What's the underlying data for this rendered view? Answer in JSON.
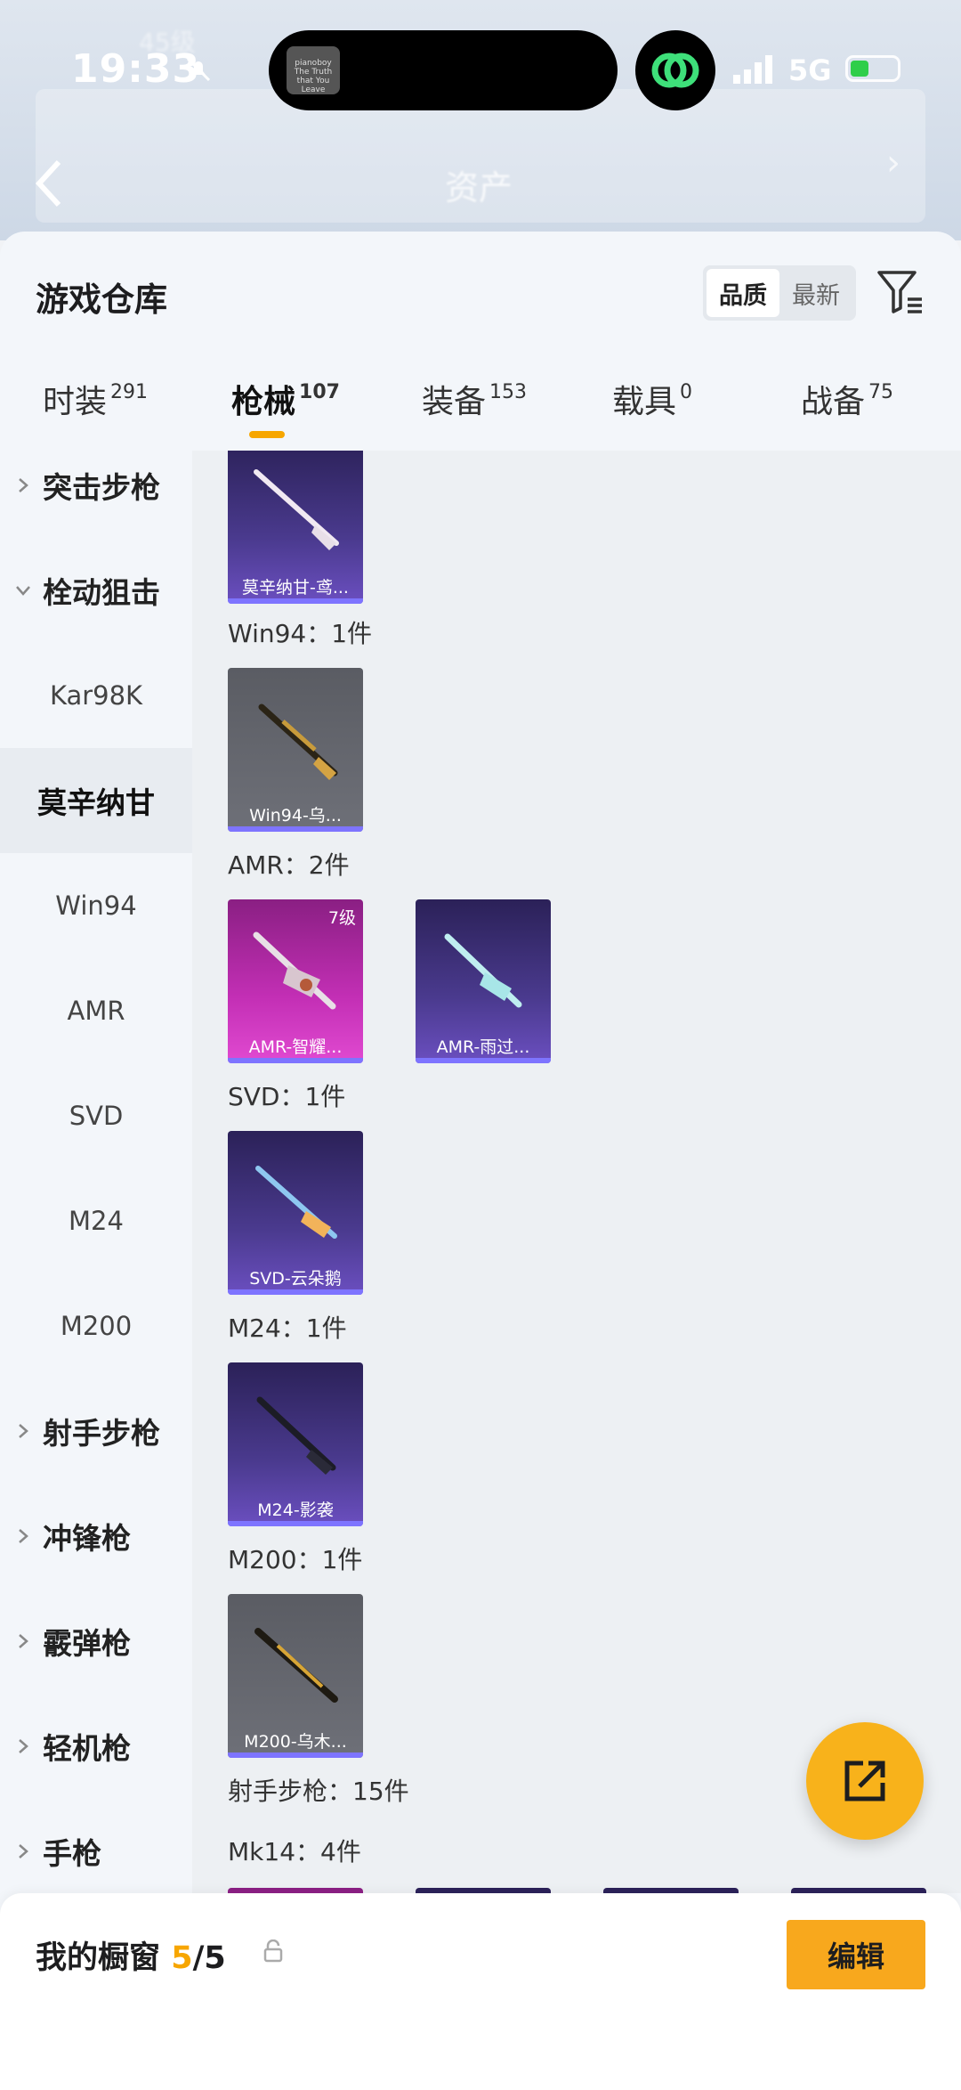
{
  "status_bar": {
    "time": "19:33",
    "network": "5G",
    "island_thumb_text": "pianoboy The Truth that You Leave"
  },
  "header": {
    "background_ghost_level": "45级",
    "assets_title": "资产"
  },
  "sheet": {
    "title": "游戏仓库",
    "sort": {
      "options": [
        "品质",
        "最新"
      ],
      "active": "品质"
    }
  },
  "tabs": [
    {
      "label": "时装",
      "count": "291",
      "active": false
    },
    {
      "label": "枪械",
      "count": "107",
      "active": true
    },
    {
      "label": "装备",
      "count": "153",
      "active": false
    },
    {
      "label": "载具",
      "count": "0",
      "active": false
    },
    {
      "label": "战备",
      "count": "75",
      "active": false
    }
  ],
  "subnav": [
    {
      "label": "突击步枪",
      "type": "group",
      "expanded": false
    },
    {
      "label": "栓动狙击",
      "type": "group",
      "expanded": true
    },
    {
      "label": "Kar98K",
      "type": "child"
    },
    {
      "label": "莫辛纳甘",
      "type": "child",
      "selected": true
    },
    {
      "label": "Win94",
      "type": "child"
    },
    {
      "label": "AMR",
      "type": "child"
    },
    {
      "label": "SVD",
      "type": "child"
    },
    {
      "label": "M24",
      "type": "child"
    },
    {
      "label": "M200",
      "type": "child"
    },
    {
      "label": "射手步枪",
      "type": "group",
      "expanded": false
    },
    {
      "label": "冲锋枪",
      "type": "group",
      "expanded": false
    },
    {
      "label": "霰弹枪",
      "type": "group",
      "expanded": false
    },
    {
      "label": "轻机枪",
      "type": "group",
      "expanded": false
    },
    {
      "label": "手枪",
      "type": "group",
      "expanded": false
    }
  ],
  "content": {
    "groups": [
      {
        "label": "",
        "items": [
          {
            "name": "莫辛纳甘-鸢...",
            "style": "purple"
          }
        ]
      },
      {
        "label": "Win94：1件",
        "items": [
          {
            "name": "Win94-乌...",
            "style": "gray"
          }
        ]
      },
      {
        "label": "AMR：2件",
        "items": [
          {
            "name": "AMR-智耀...",
            "style": "pink",
            "badge": "7级"
          },
          {
            "name": "AMR-雨过...",
            "style": "purple"
          }
        ]
      },
      {
        "label": "SVD：1件",
        "items": [
          {
            "name": "SVD-云朵鹅",
            "style": "purple"
          }
        ]
      },
      {
        "label": "M24：1件",
        "items": [
          {
            "name": "M24-影袭",
            "style": "purple"
          }
        ]
      },
      {
        "label": "M200：1件",
        "items": [
          {
            "name": "M200-乌木...",
            "style": "gray"
          }
        ]
      }
    ],
    "section_label": "射手步枪：15件",
    "next_group_label": "Mk14：4件"
  },
  "bottom": {
    "title": "我的橱窗",
    "count_current": "5",
    "count_total": "/5",
    "edit_label": "编辑"
  },
  "colors": {
    "accent": "#f7a600",
    "fab": "#f8b21b",
    "card_bar": "#7e74ff"
  }
}
